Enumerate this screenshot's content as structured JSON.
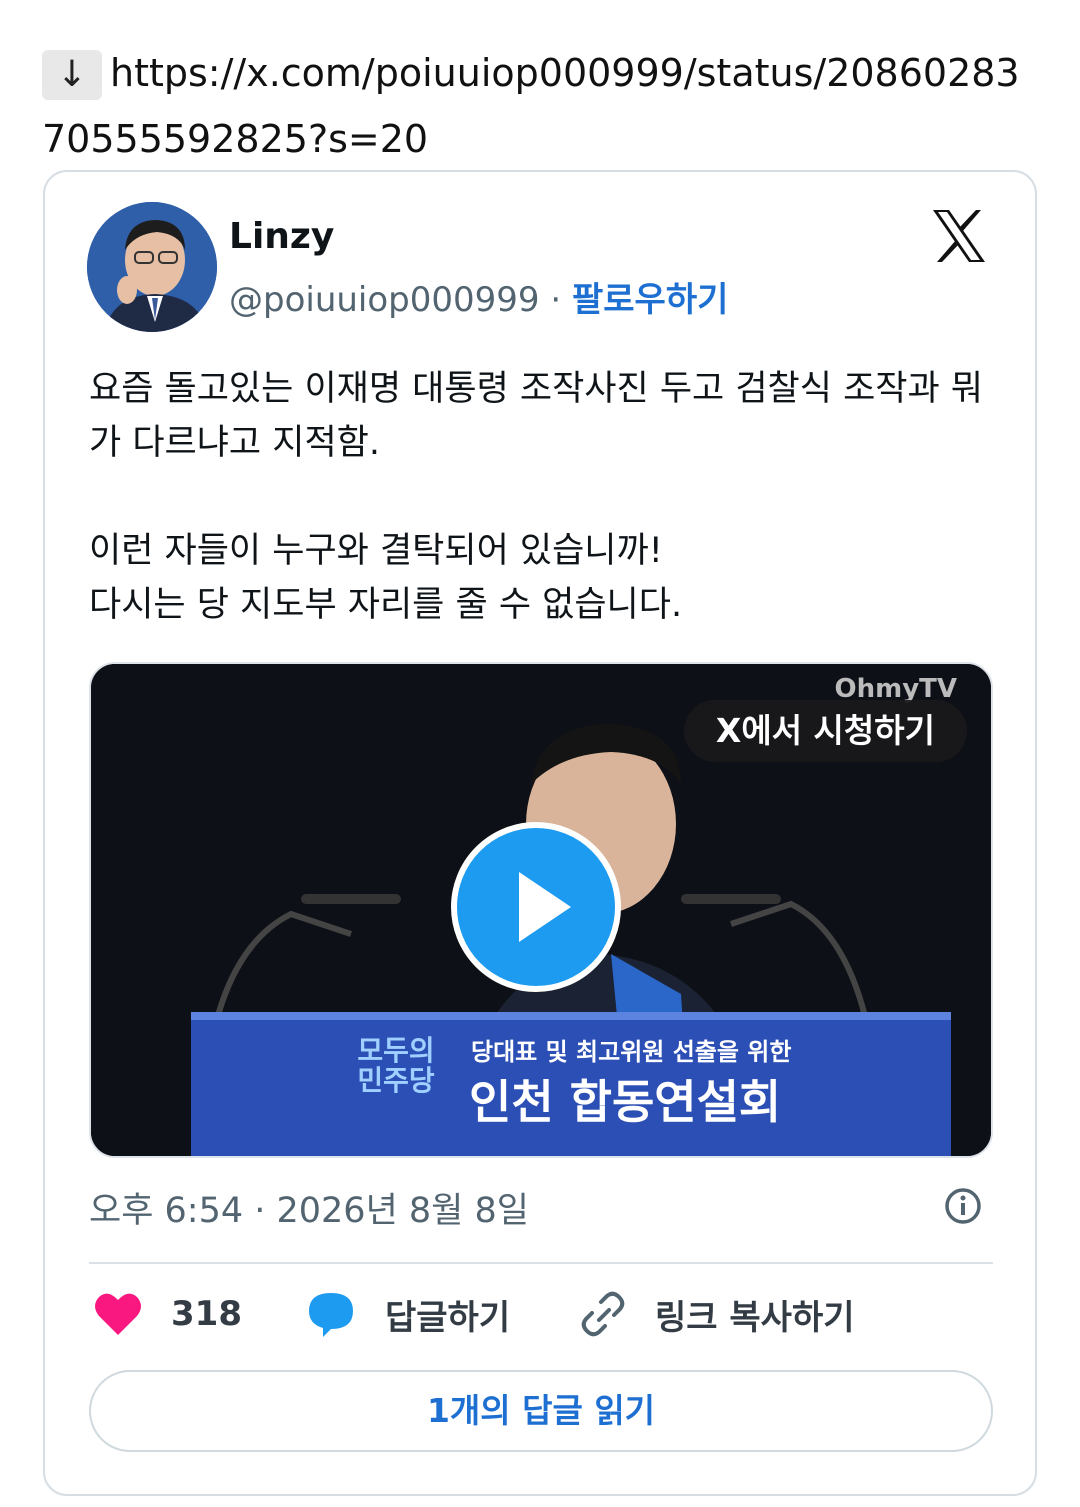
{
  "link": {
    "arrow_icon": "down-arrow-icon",
    "arrow_glyph": "↓",
    "url": "https://x.com/poiuuiop000999/status/2086028370555592825?s=20"
  },
  "tweet": {
    "author_name": "Linzy",
    "handle": "@poiuuiop000999",
    "separator": "·",
    "follow_label": "팔로우하기",
    "text": "요즘 돌고있는 이재명 대통령 조작사진 두고 검찰식 조작과 뭐가 다르냐고 지적함.\n\n이런 자들이 누구와 결탁되어 있습니까!\n다시는 당 지도부 자리를 줄 수 없습니다.",
    "media": {
      "watch_label": "X에서 시청하기",
      "watermark": "OhmyTV",
      "banner_logo_line1": "모두의",
      "banner_logo_line2": "민주당",
      "banner_subtitle": "당대표 및 최고위원 선출을 위한",
      "banner_title": "인천 합동연설회"
    },
    "timestamp": "오후 6:54 · 2026년 8월 8일",
    "likes": "318",
    "reply_label": "답글하기",
    "copy_link_label": "링크 복사하기",
    "read_replies_label": "1개의 답글 읽기"
  },
  "colors": {
    "accent": "#1d9bf0",
    "link": "#1d6fd1",
    "heart": "#f91880",
    "text_secondary": "#536471"
  }
}
